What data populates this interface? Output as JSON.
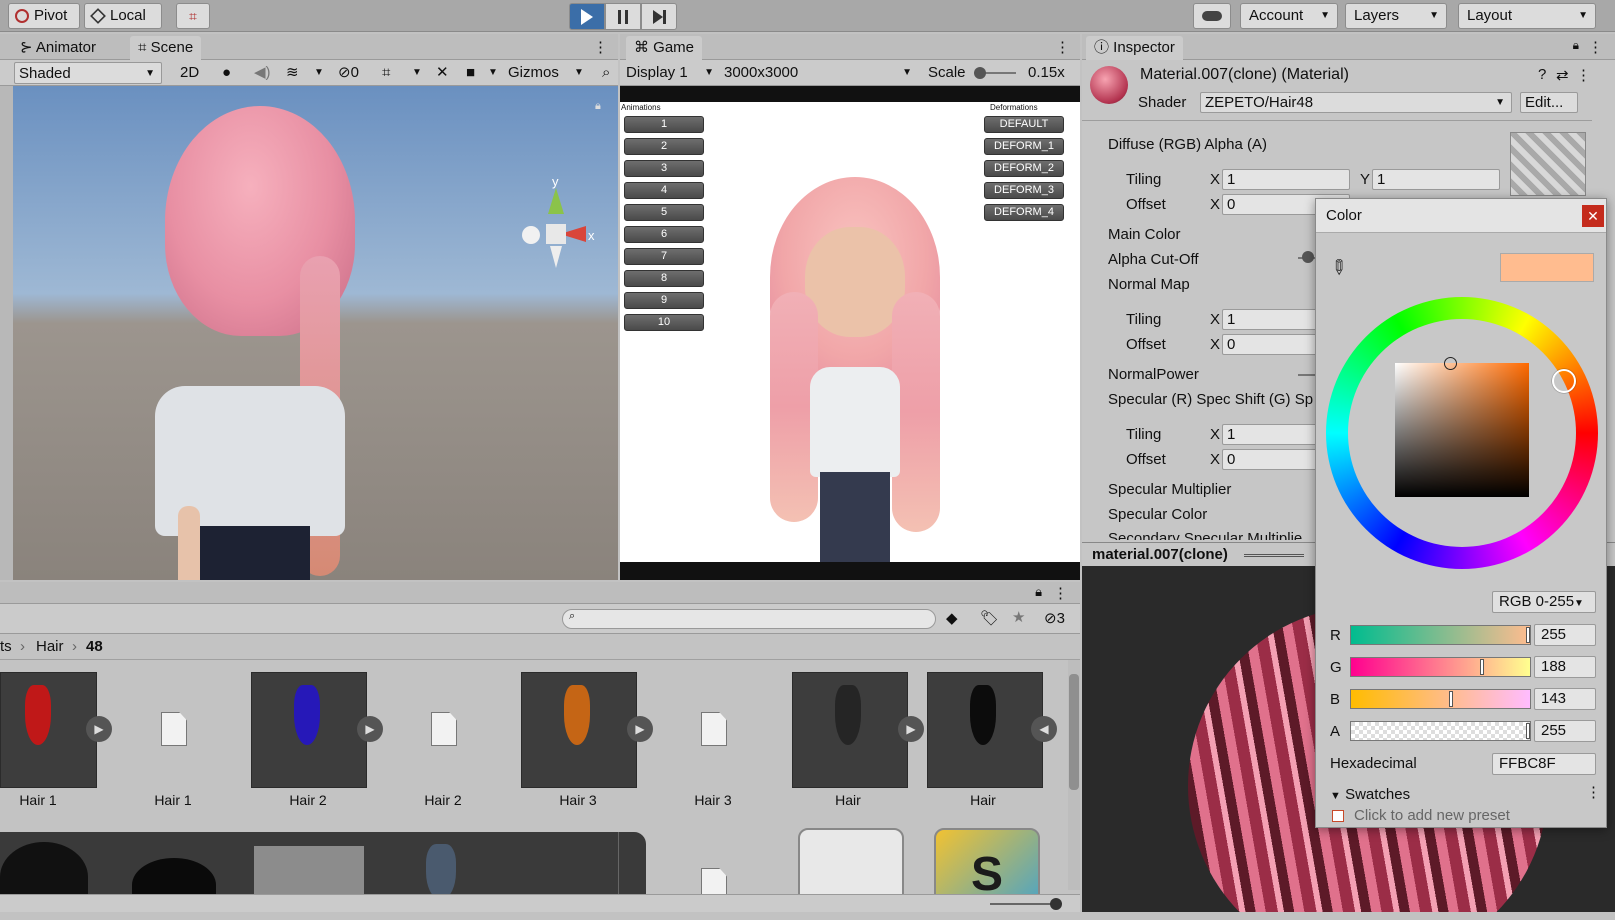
{
  "toolbar": {
    "pivot_label": "Pivot",
    "local_label": "Local",
    "account_label": "Account",
    "layers_label": "Layers",
    "layout_label": "Layout"
  },
  "scene": {
    "tabs": [
      "Animator",
      "Scene"
    ],
    "shading_mode": "Shaded",
    "mode_2d": "2D",
    "hidden_count": "0",
    "gizmos_label": "Gizmos",
    "axis_y": "y",
    "axis_x": "x"
  },
  "game": {
    "tab": "Game",
    "display": "Display 1",
    "resolution": "3000x3000",
    "scale_label": "Scale",
    "scale_value": "0.15x",
    "scale_fraction": 0.1,
    "animations_label": "Animations",
    "deformations_label": "Deformations",
    "anim_buttons": [
      "1",
      "2",
      "3",
      "4",
      "5",
      "6",
      "7",
      "8",
      "9",
      "10"
    ],
    "deform_buttons": [
      "DEFAULT",
      "DEFORM_1",
      "DEFORM_2",
      "DEFORM_3",
      "DEFORM_4"
    ]
  },
  "project": {
    "hidden_count": "3",
    "breadcrumb": [
      "ts",
      "Hair",
      "48"
    ],
    "assets": [
      "Hair 1",
      "Hair 1",
      "Hair 2",
      "Hair 2",
      "Hair 3",
      "Hair 3",
      "Hair",
      "Hair"
    ]
  },
  "inspector": {
    "tab": "Inspector",
    "material_title": "Material.007(clone) (Material)",
    "shader_label": "Shader",
    "shader_value": "ZEPETO/Hair48",
    "edit_label": "Edit...",
    "diffuse_label": "Diffuse (RGB) Alpha (A)",
    "tiling_label": "Tiling",
    "offset_label": "Offset",
    "x_label": "X",
    "y_label": "Y",
    "tiling_x": "1",
    "tiling_y": "1",
    "offset_x": "0",
    "main_color_label": "Main Color",
    "alpha_cutoff_label": "Alpha Cut-Off",
    "normal_map_label": "Normal Map",
    "normal_power_label": "NormalPower",
    "specular_label": "Specular (R) Spec Shift (G) Sp",
    "spec_mult_label": "Specular Multiplier",
    "spec_color_label": "Specular Color",
    "secondary_label": "Secondary Specular Multiplie",
    "preview_label": "material.007(clone)"
  },
  "color_picker": {
    "title": "Color",
    "mode": "RGB 0-255",
    "swatch_color": "#FFBC8F",
    "channels": [
      {
        "label": "R",
        "value": "255",
        "fraction": 1.0
      },
      {
        "label": "G",
        "value": "188",
        "fraction": 0.737
      },
      {
        "label": "B",
        "value": "143",
        "fraction": 0.561
      },
      {
        "label": "A",
        "value": "255",
        "fraction": 1.0
      }
    ],
    "hex_label": "Hexadecimal",
    "hex_value": "FFBC8F",
    "swatches_label": "Swatches",
    "preset_hint": "Click to add new preset"
  },
  "colors": {
    "accent_play": "#3b6ea8",
    "editor_bg": "#c2c2c2"
  }
}
